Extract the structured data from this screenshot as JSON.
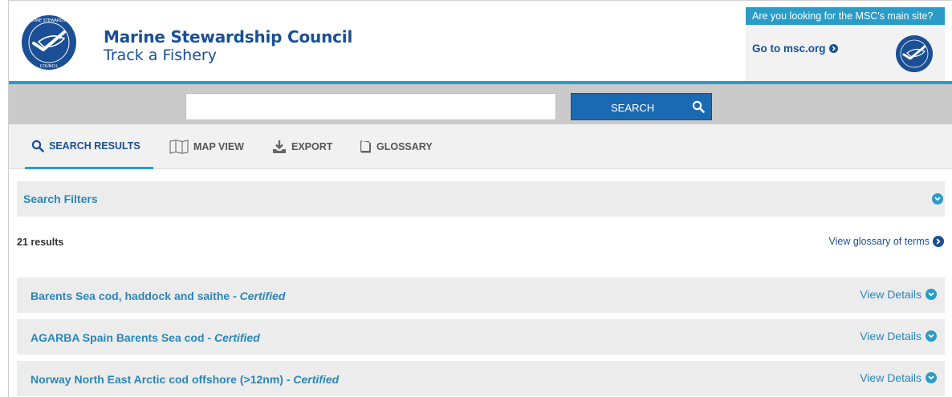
{
  "colors": {
    "brand": "#1a4f95",
    "accent": "#2a9cc8",
    "search_button": "#1a6ab3"
  },
  "header": {
    "title": "Marine Stewardship Council",
    "subtitle": "Track a Fishery",
    "logo_icon": "msc-fish-logo-icon"
  },
  "msc_box": {
    "banner": "Are you looking for the MSC's main site?",
    "link": "Go to msc.org",
    "logo_icon": "msc-fish-logo-icon"
  },
  "search": {
    "value": "",
    "placeholder": "",
    "button_label": "SEARCH",
    "icon": "search-icon"
  },
  "tabs": [
    {
      "label": "SEARCH RESULTS",
      "icon": "search-icon",
      "active": true
    },
    {
      "label": "MAP VIEW",
      "icon": "map-icon",
      "active": false
    },
    {
      "label": "EXPORT",
      "icon": "download-icon",
      "active": false
    },
    {
      "label": "GLOSSARY",
      "icon": "book-icon",
      "active": false
    }
  ],
  "filters": {
    "label": "Search Filters",
    "icon": "chevron-down-icon"
  },
  "results": {
    "count_label": "21 results",
    "glossary_link": "View glossary of terms",
    "items": [
      {
        "name": "Barents Sea cod, haddock and saithe",
        "separator": " - ",
        "status": "Certified",
        "action": "View Details"
      },
      {
        "name": "AGARBA Spain Barents Sea cod",
        "separator": " - ",
        "status": "Certified",
        "action": "View Details"
      },
      {
        "name": "Norway North East Arctic cod offshore (>12nm)",
        "separator": " - ",
        "status": "Certified",
        "action": "View Details"
      }
    ]
  }
}
